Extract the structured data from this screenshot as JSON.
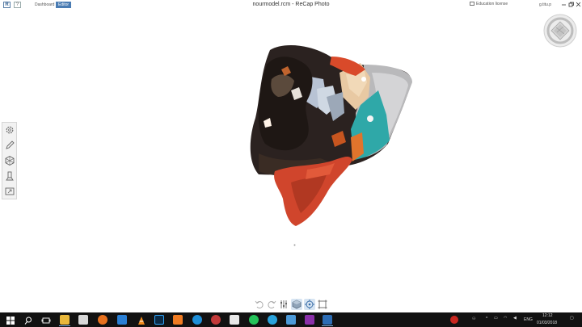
{
  "titlebar": {
    "logo_letter": "R",
    "help_label": "?",
    "tabs": [
      "Dashboard",
      "Editor"
    ],
    "window_title": "nourmodel.rcm - ReCap Photo",
    "license_text": "Education license",
    "user_name": "g.titu.p",
    "window_controls": [
      "minimize-icon",
      "restore-icon",
      "close-icon"
    ]
  },
  "left_toolbar": {
    "tools": [
      "settings-icon",
      "pencil-icon",
      "hexagon-mesh-icon",
      "measure-icon",
      "export-icon"
    ]
  },
  "bottom_toolbar": {
    "tools": [
      "undo-icon",
      "redo-icon",
      "sliders-icon",
      "solid-view-icon",
      "orbit-icon",
      "crop-box-icon"
    ]
  },
  "taskbar": {
    "apps": [
      "start-icon",
      "search-icon",
      "task-view-icon",
      "file-explorer-icon",
      "store-icon",
      "firefox-icon",
      "store-bag-icon",
      "vlc-icon",
      "photoshop-icon",
      "app-orange-icon",
      "ccleaner-icon",
      "app-red-icon",
      "calculator-icon",
      "whatsapp-icon",
      "telegram-icon",
      "app-blue-icon",
      "onenote-icon",
      "recap-icon"
    ],
    "language": "ENG",
    "time": "12:12",
    "date": "01/03/2018"
  },
  "colors": {
    "accent": "#4a7cb3",
    "taskbar": "#121212",
    "model_red": "#d94a2a",
    "model_teal": "#2fa8a8"
  }
}
